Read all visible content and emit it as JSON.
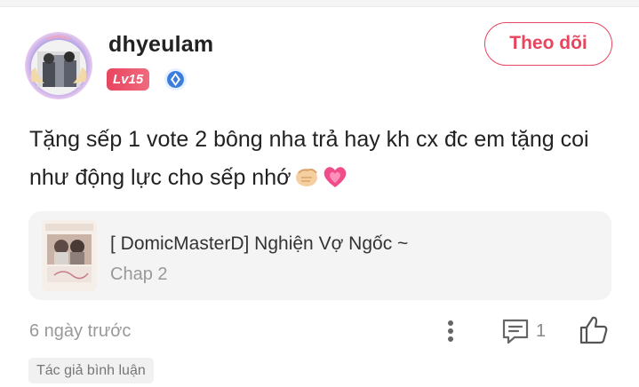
{
  "comment": {
    "username": "dhyeulam",
    "level": "Lv15",
    "follow_label": "Theo dõi",
    "text": "Tặng sếp 1 vote 2 bông nha trả hay kh cx đc em tặng coi như động lực cho sếp nhớ",
    "emojis": [
      "fist-bump-emoji",
      "growing-heart-emoji"
    ],
    "time_ago": "6 ngày trước",
    "reply_count": "1",
    "author_tag": "Tác giả bình luận"
  },
  "book": {
    "title": "[ DomicMasterD] Nghiện Vợ Ngốc ~",
    "chapter": "Chap 2"
  },
  "icons": {
    "verified": "verified-badge-icon",
    "more": "more-vertical-icon",
    "reply": "comment-icon",
    "like": "thumbs-up-icon"
  },
  "colors": {
    "accent": "#e8455f",
    "muted": "#999999",
    "card_bg": "#f4f4f4"
  }
}
